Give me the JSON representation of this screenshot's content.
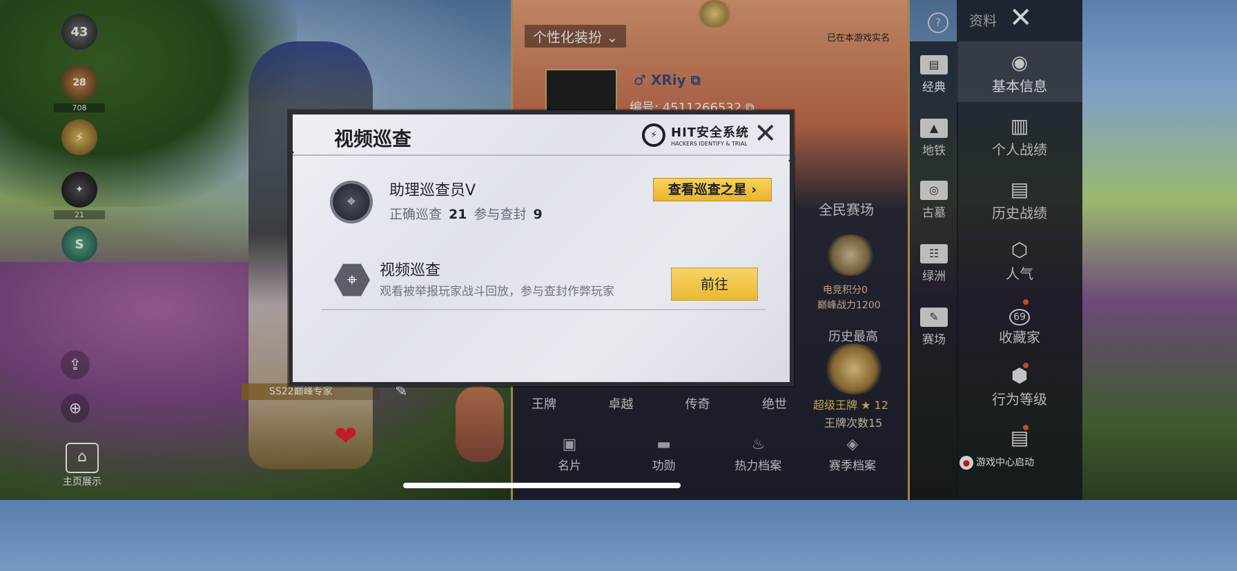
{
  "hud": {
    "level": "43",
    "badge1_value": "28",
    "badge1_caption": "708",
    "badge3_caption": "21",
    "badge4_letter": "S",
    "home_label": "主页展示",
    "season_tag": "SS22巅峰专家"
  },
  "profile": {
    "personal_dress": "个性化装扮",
    "realname_status": "已在本游戏实名",
    "player_name": "XRiy",
    "player_id": "编号: 4511266532",
    "mode_title": "全民赛场",
    "esports_score": "电竞积分0",
    "peak_power": "巅峰战力1200",
    "history_best_title": "历史最高",
    "history_rank": "超级王牌 ★ 12",
    "ace_count": "王牌次数15",
    "tiers": [
      "王牌",
      "卓越",
      "传奇",
      "绝世"
    ],
    "bottom_tabs": [
      {
        "label": "名片",
        "icon": "id-card-icon"
      },
      {
        "label": "功勋",
        "icon": "medal-icon"
      },
      {
        "label": "热力档案",
        "icon": "flame-icon"
      },
      {
        "label": "赛季档案",
        "icon": "season-icon"
      }
    ]
  },
  "nav": {
    "top_label": "资料",
    "mid_items": [
      "经典",
      "地铁",
      "古墓",
      "绿洲",
      "赛场"
    ],
    "side_items": [
      "基本信息",
      "个人战绩",
      "历史战绩",
      "人气",
      "收藏家",
      "行为等级"
    ],
    "collector_badge": "69",
    "game_center": "游戏中心启动"
  },
  "dialog": {
    "title": "视频巡查",
    "logo_main": "HIT安全系统",
    "logo_sub": "HACKERS IDENTIFY & TRIAL",
    "role": "助理巡查员V",
    "correct_label": "正确巡查",
    "correct_value": "21",
    "ban_label": "参与查封",
    "ban_value": "9",
    "star_button": "查看巡查之星",
    "feature_title": "视频巡查",
    "feature_desc": "观看被举报玩家战斗回放，参与查封作弊玩家",
    "go_button": "前往"
  },
  "colors": {
    "accent_gold": "#e9b932",
    "dialog_bg": "#dfe2ea",
    "notify_dot": "#e8602c"
  }
}
